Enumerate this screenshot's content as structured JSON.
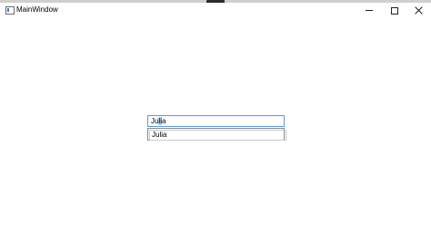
{
  "window": {
    "title": "MainWindow"
  },
  "textbox": {
    "typed": "Ju",
    "selected": "li",
    "remainder": "a"
  },
  "suggestions": [
    {
      "label": "Julia"
    }
  ],
  "colors": {
    "textbox_border": "#5a9bd5",
    "selection": "#a9cdf0"
  },
  "icons": {
    "app": "window-icon",
    "minimize": "minimize-icon",
    "maximize": "maximize-icon",
    "close": "close-icon"
  }
}
